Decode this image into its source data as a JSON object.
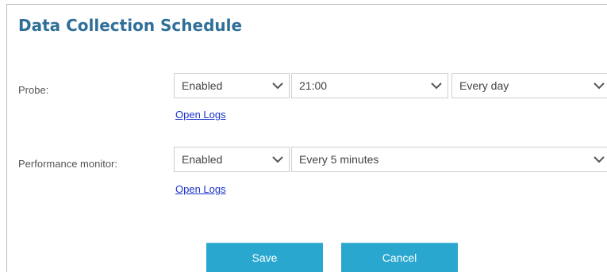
{
  "page": {
    "title": "Data Collection Schedule"
  },
  "probe": {
    "label": "Probe:",
    "status": "Enabled",
    "time": "21:00",
    "frequency": "Every day",
    "logs_link": "Open Logs"
  },
  "performance_monitor": {
    "label": "Performance monitor:",
    "status": "Enabled",
    "interval": "Every 5 minutes",
    "logs_link": "Open Logs"
  },
  "actions": {
    "save_label": "Save",
    "cancel_label": "Cancel"
  },
  "icons": {
    "dropdown": "chevron-down-icon"
  },
  "colors": {
    "title": "#2f6f98",
    "link": "#1a33cc",
    "button": "#2aa7cf"
  }
}
